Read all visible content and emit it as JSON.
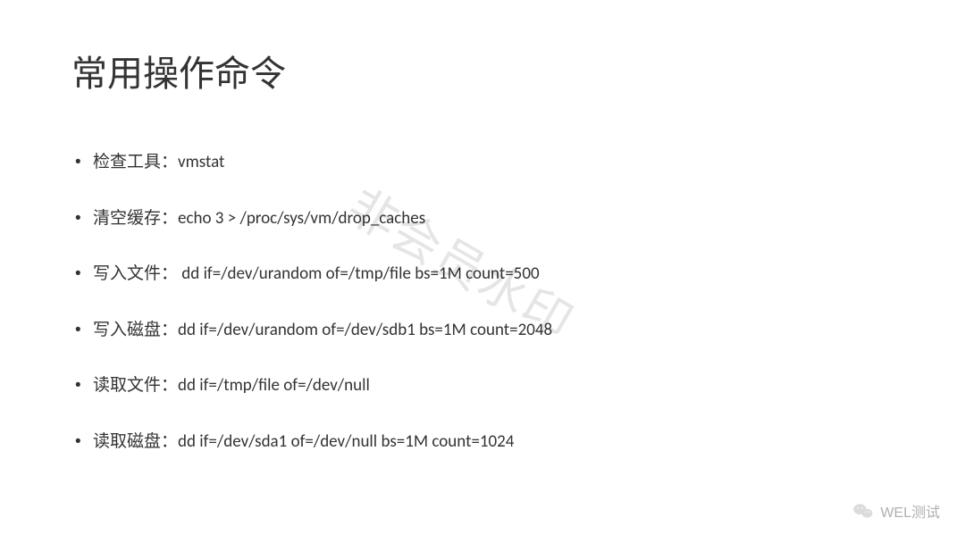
{
  "title": "常用操作命令",
  "bullets": [
    {
      "label": "检查工具：",
      "command": "vmstat"
    },
    {
      "label": "清空缓存：",
      "command": "echo 3 > /proc/sys/vm/drop_caches"
    },
    {
      "label": "写入文件：",
      "command": " dd if=/dev/urandom of=/tmp/file bs=1M count=500"
    },
    {
      "label": "写入磁盘：",
      "command": "dd if=/dev/urandom of=/dev/sdb1 bs=1M count=2048"
    },
    {
      "label": "读取文件：",
      "command": "dd if=/tmp/file of=/dev/null"
    },
    {
      "label": "读取磁盘：",
      "command": "dd if=/dev/sda1 of=/dev/null bs=1M count=1024"
    }
  ],
  "watermark": "非会员水印",
  "footer_brand": "WEL测试"
}
